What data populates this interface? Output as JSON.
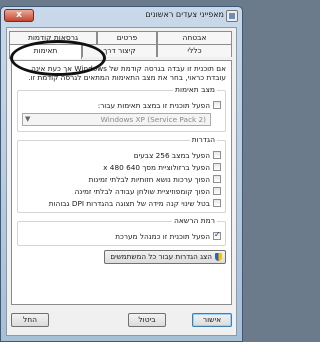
{
  "window": {
    "title": "מאפייני צעדים ראשונים",
    "close_label": "x"
  },
  "tabs": [
    {
      "label": "אבטחה",
      "active": false
    },
    {
      "label": "פרטים",
      "active": false
    },
    {
      "label": "גרסאות קודמות",
      "active": false
    },
    {
      "label": "כללי",
      "active": false
    },
    {
      "label": "קיצור דרך",
      "active": false
    },
    {
      "label": "תאימות",
      "active": true
    }
  ],
  "description": "אם תוכנית זו עבדה בגרסה קודמת של Windows אך כעת אינה עובדת כראוי, בחר את מצב התאימות המתאים לגרסה קודמת זו.",
  "compat_mode": {
    "title": "מצב תאימות",
    "checkbox_label": "הפעל תוכנית זו במצב תאימות עבור:",
    "checked": false,
    "select_value": "Windows XP (Service Pack 2)"
  },
  "settings": {
    "title": "הגדרות",
    "options": [
      {
        "label": "הפעל במצב 256 צבעים",
        "checked": false
      },
      {
        "label": "הפעל ברזולוציית מסך 640 x 480",
        "checked": false
      },
      {
        "label": "הפוך ערכות נושא חזותיות לבלתי זמינות",
        "checked": false
      },
      {
        "label": "הפוך קומפוזיציית שולחן עבודה לבלתי זמינה",
        "checked": false
      },
      {
        "label": "בטל שינוי קנה מידה של תצוגה בהגדרות DPI גבוהות",
        "checked": false
      }
    ]
  },
  "privilege": {
    "title": "רמת הרשאה",
    "checkbox_label": "הפעל תוכנית זו כמנהל מערכת",
    "checked": true
  },
  "all_users_button": "הצג הגדרות עבור כל המשתמשים",
  "buttons": {
    "ok": "אישור",
    "cancel": "ביטול",
    "apply": "החל"
  }
}
